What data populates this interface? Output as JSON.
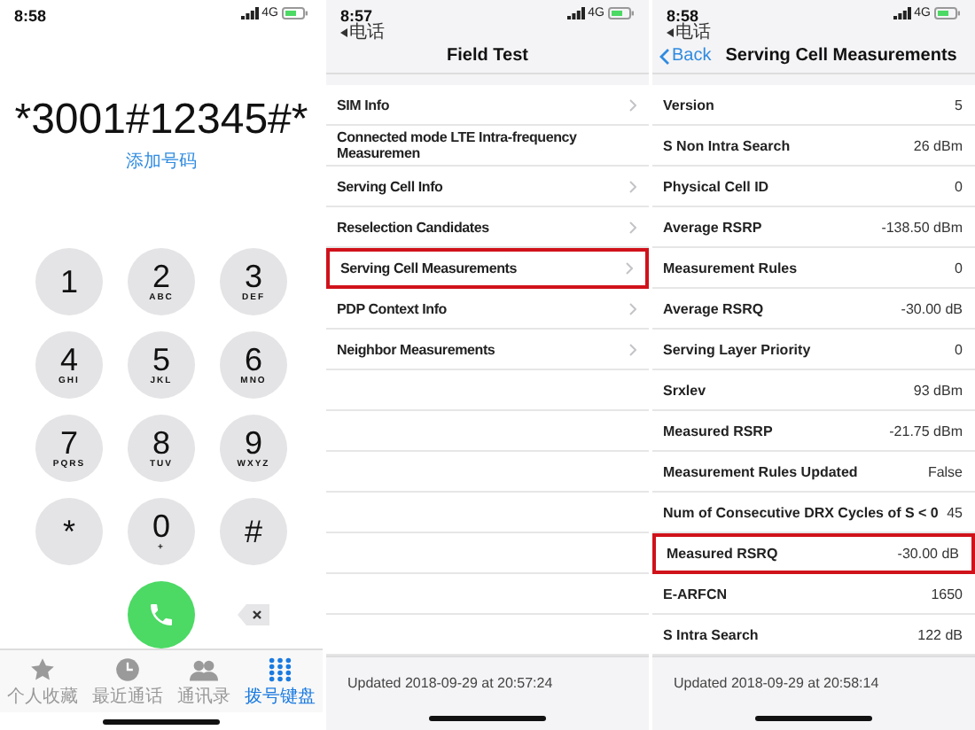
{
  "dialer": {
    "status": {
      "time": "8:58",
      "network": "4G"
    },
    "number": "*3001#12345#*",
    "add_number": "添加号码",
    "keys": [
      {
        "digit": "1"
      },
      {
        "digit": "2",
        "letters": "ABC"
      },
      {
        "digit": "3",
        "letters": "DEF"
      },
      {
        "digit": "4",
        "letters": "GHI"
      },
      {
        "digit": "5",
        "letters": "JKL"
      },
      {
        "digit": "6",
        "letters": "MNO"
      },
      {
        "digit": "7",
        "letters": "PQRS"
      },
      {
        "digit": "8",
        "letters": "TUV"
      },
      {
        "digit": "9",
        "letters": "WXYZ"
      },
      {
        "digit": "*"
      },
      {
        "digit": "0",
        "letters": "+"
      },
      {
        "digit": "#"
      }
    ],
    "tabs": [
      {
        "label": "个人收藏",
        "kind": "star",
        "selected": false
      },
      {
        "label": "最近通话",
        "kind": "clock",
        "selected": false
      },
      {
        "label": "通讯录",
        "kind": "people",
        "selected": false
      },
      {
        "label": "拨号键盘",
        "kind": "keypad",
        "selected": true
      }
    ]
  },
  "field_test": {
    "status": {
      "time": "8:57",
      "network": "4G",
      "back_app": "电话"
    },
    "title": "Field Test",
    "items": [
      {
        "label": "SIM Info",
        "chevron": true,
        "highlighted": false
      },
      {
        "label": "Connected mode LTE Intra-frequency Measuremen",
        "chevron": false,
        "highlighted": false
      },
      {
        "label": "Serving Cell Info",
        "chevron": true,
        "highlighted": false
      },
      {
        "label": "Reselection Candidates",
        "chevron": true,
        "highlighted": false
      },
      {
        "label": "Serving Cell Measurements",
        "chevron": true,
        "highlighted": true
      },
      {
        "label": "PDP Context Info",
        "chevron": true,
        "highlighted": false
      },
      {
        "label": "Neighbor Measurements",
        "chevron": true,
        "highlighted": false
      }
    ],
    "updated": "Updated 2018-09-29 at 20:57:24"
  },
  "measurements": {
    "status": {
      "time": "8:58",
      "network": "4G",
      "back_app": "电话"
    },
    "back": "Back",
    "title": "Serving Cell Measurements",
    "rows": [
      {
        "label": "Version",
        "value": "5",
        "highlighted": false
      },
      {
        "label": "S Non Intra Search",
        "value": "26 dBm",
        "highlighted": false
      },
      {
        "label": "Physical Cell ID",
        "value": "0",
        "highlighted": false
      },
      {
        "label": "Average RSRP",
        "value": "-138.50 dBm",
        "highlighted": false
      },
      {
        "label": "Measurement Rules",
        "value": "0",
        "highlighted": false
      },
      {
        "label": "Average RSRQ",
        "value": "-30.00 dB",
        "highlighted": false
      },
      {
        "label": "Serving Layer Priority",
        "value": "0",
        "highlighted": false
      },
      {
        "label": "Srxlev",
        "value": "93 dBm",
        "highlighted": false
      },
      {
        "label": "Measured RSRP",
        "value": "-21.75 dBm",
        "highlighted": false
      },
      {
        "label": "Measurement Rules Updated",
        "value": "False",
        "highlighted": false
      },
      {
        "label": "Num of Consecutive DRX Cycles of S < 0",
        "value": "45",
        "highlighted": false
      },
      {
        "label": "Measured RSRQ",
        "value": "-30.00 dB",
        "highlighted": true
      },
      {
        "label": "E-ARFCN",
        "value": "1650",
        "highlighted": false
      },
      {
        "label": "S Intra Search",
        "value": "122 dB",
        "highlighted": false
      }
    ],
    "updated": "Updated 2018-09-29 at 20:58:14"
  }
}
